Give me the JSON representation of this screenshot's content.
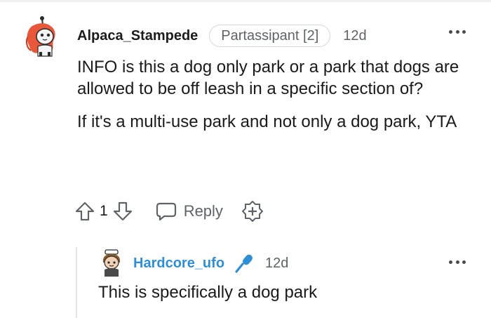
{
  "comment": {
    "author": "Alpaca_Stampede",
    "flair": "Partassipant [2]",
    "age": "12d",
    "paragraphs": [
      "INFO is this a dog only park or a park that dogs are allowed to be off leash in a specific section of?",
      "If it's a multi-use park and not only a dog park, YTA"
    ],
    "vote_count": "1",
    "reply_label": "Reply",
    "icons": {
      "more": "more-options-icon",
      "upvote": "upvote-arrow-icon",
      "downvote": "downvote-arrow-icon",
      "reply": "speech-bubble-icon",
      "award": "award-plus-icon"
    }
  },
  "reply": {
    "author": "Hardcore_ufo",
    "age": "12d",
    "text": "This is specifically a dog park",
    "icons": {
      "badge": "microphone-icon",
      "more": "more-options-icon"
    },
    "username_color": "#2e8fd6"
  },
  "colors": {
    "text": "#1a1a1b",
    "muted": "#5f6368",
    "accent": "#2e8fd6",
    "flair_border": "#d6d8db"
  }
}
